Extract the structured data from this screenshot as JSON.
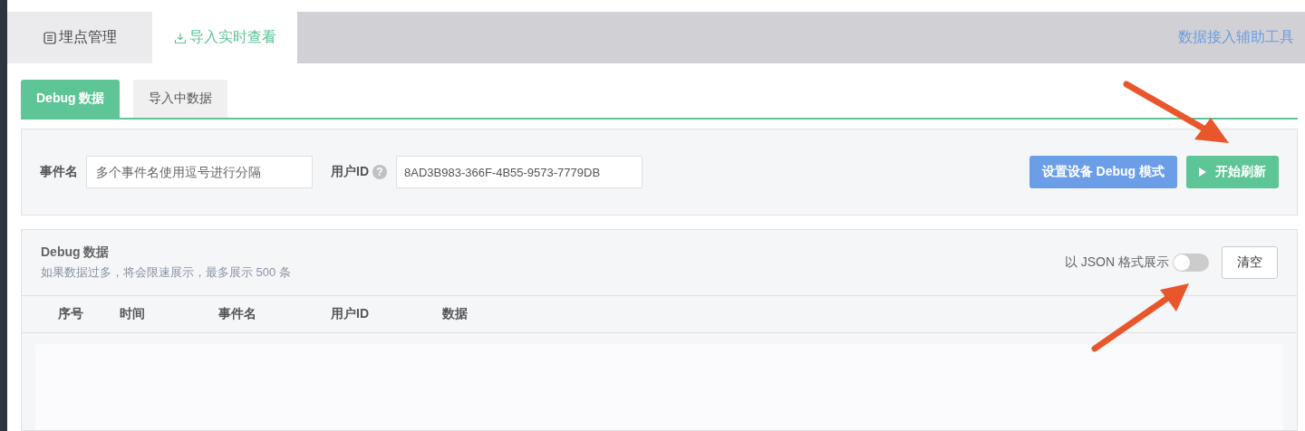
{
  "top_tabs": [
    {
      "label": "埋点管理",
      "selected": false
    },
    {
      "label": "导入实时查看",
      "selected": true
    }
  ],
  "tool_link": "数据接入辅助工具",
  "sub_tabs": [
    {
      "label": "Debug 数据",
      "selected": true
    },
    {
      "label": "导入中数据",
      "selected": false
    }
  ],
  "filter": {
    "event_label": "事件名",
    "event_placeholder": "多个事件名使用逗号进行分隔",
    "user_label": "用户ID",
    "help_mark": "?",
    "user_value": "8AD3B983-366F-4B55-9573-7779DB",
    "buttons": [
      {
        "label": "设置设备 Debug 模式",
        "kind": "primary"
      },
      {
        "label": "开始刷新",
        "kind": "play"
      }
    ]
  },
  "debug_panel": {
    "title": "Debug 数据",
    "subtitle": "如果数据过多，将会限速展示，最多展示 500 条",
    "toggle_label": "以 JSON 格式展示",
    "toggle_on": false,
    "clear_button": "清空",
    "columns": [
      "序号",
      "时间",
      "事件名",
      "用户ID",
      "数据"
    ]
  }
}
